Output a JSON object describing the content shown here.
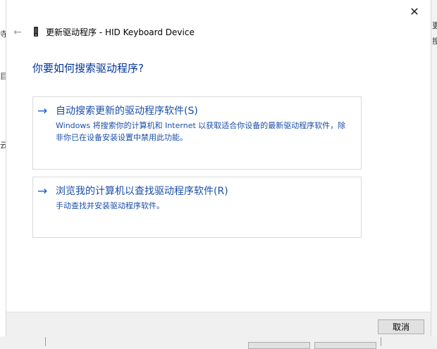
{
  "background": {
    "left_fragments": [
      "寺",
      "目",
      "云"
    ],
    "right_fragments": [
      "更",
      "搜"
    ]
  },
  "dialog": {
    "close_glyph": "✕",
    "back_glyph": "←",
    "title": "更新驱动程序 - HID Keyboard Device",
    "heading": "你要如何搜索驱动程序?",
    "options": [
      {
        "arrow": "→",
        "title": "自动搜索更新的驱动程序软件(S)",
        "description": "Windows 将搜索你的计算机和 Internet 以获取适合你设备的最新驱动程序软件，除非你已在设备安装设置中禁用此功能。"
      },
      {
        "arrow": "→",
        "title": "浏览我的计算机以查找驱动程序软件(R)",
        "description": "手动查找并安装驱动程序软件。"
      }
    ],
    "cancel_label": "取消"
  },
  "colors": {
    "heading": "#003399",
    "link": "#1a4ea8",
    "arrow": "#1a5bd6"
  }
}
